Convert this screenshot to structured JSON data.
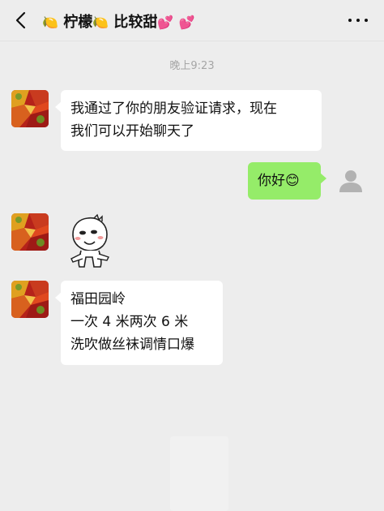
{
  "header": {
    "title_prefix_emoji": "🍋",
    "title_name": "柠檬",
    "title_mid_emoji": "🍋",
    "title_suffix": "比较甜",
    "title_trail_emoji_1": "💕",
    "title_trail_emoji_2": "💕"
  },
  "chat": {
    "timestamp": "晚上9:23",
    "messages": [
      {
        "side": "left",
        "lines": [
          "我通过了你的朋友验证请求，现在",
          "我们可以开始聊天了"
        ]
      },
      {
        "side": "right",
        "text": "你好",
        "emoji": "😊"
      },
      {
        "side": "left",
        "type": "sticker",
        "sticker": "smug-face-sticker"
      },
      {
        "side": "left",
        "lines": [
          "福田园岭",
          "一次 4 米两次 6 米",
          "洗吹做丝袜调情口爆"
        ]
      }
    ]
  },
  "colors": {
    "background": "#ededed",
    "bubble_left": "#ffffff",
    "bubble_right": "#95ec69",
    "timestamp": "#a6a6a6"
  },
  "icons": {
    "back": "chevron-left-icon",
    "more": "more-dots-icon",
    "self_avatar": "default-user-avatar-icon"
  }
}
